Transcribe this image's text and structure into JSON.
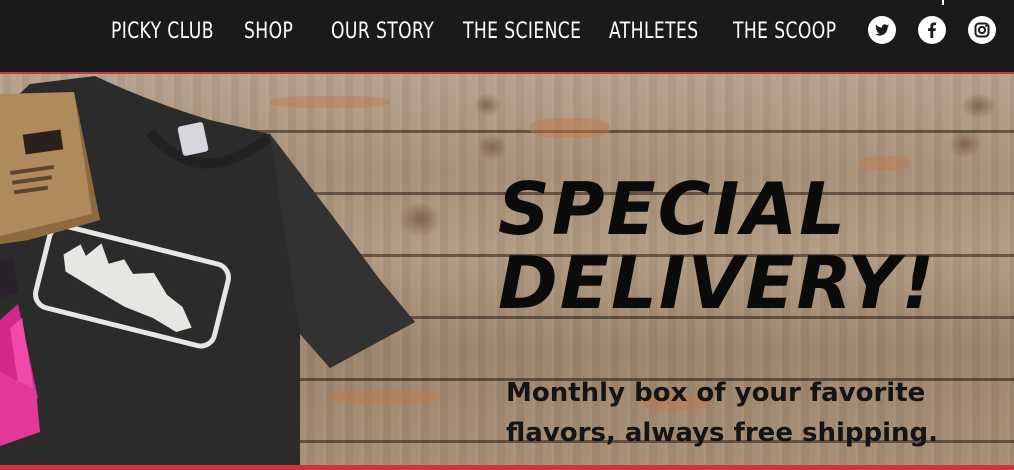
{
  "nav": {
    "items": [
      {
        "label": "PICKY CLUB"
      },
      {
        "label": "SHOP"
      },
      {
        "label": "OUR STORY"
      },
      {
        "label": "THE SCIENCE"
      },
      {
        "label": "ATHLETES"
      },
      {
        "label": "THE SCOOP"
      }
    ],
    "social": [
      "twitter-icon",
      "facebook-icon",
      "instagram-icon"
    ]
  },
  "hero": {
    "headline_line1": "SPECIAL",
    "headline_line2": "DELIVERY!",
    "subhead_line1": "Monthly box of your favorite",
    "subhead_line2": "flavors, always free shipping."
  },
  "colors": {
    "nav_bg": "#1b1919",
    "accent_red": "#d0333b",
    "headline": "#0b0b0b",
    "wood": "#a89078"
  }
}
